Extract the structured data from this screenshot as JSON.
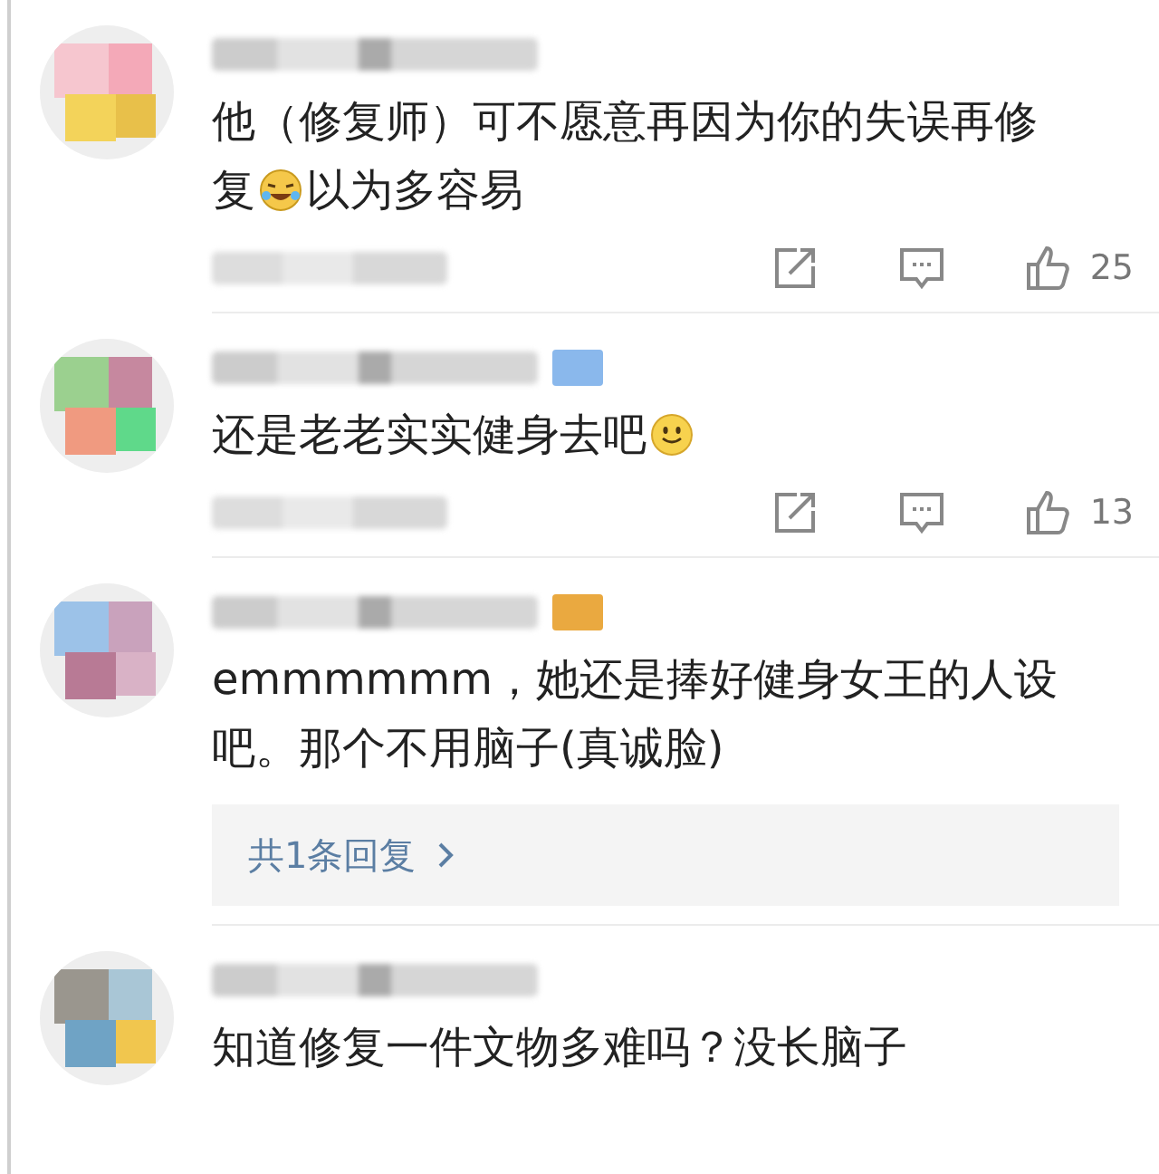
{
  "comments": [
    {
      "body": [
        {
          "kind": "text",
          "text": "他（修复师）可不愿意再因为你的失误再修复"
        },
        {
          "kind": "laughing"
        },
        {
          "kind": "text",
          "text": "以为多容易"
        }
      ],
      "likes": "25"
    },
    {
      "color": "#8ab8ec",
      "body": [
        {
          "kind": "text",
          "text": "还是老老实实健身去吧"
        },
        {
          "kind": "smiling"
        }
      ],
      "likes": "13"
    },
    {
      "color": "#eaa940",
      "body": [
        {
          "kind": "text",
          "text": "emmmmmm，她还是捧好健身女王的人设吧。那个不用脑子(真诚脸)"
        }
      ],
      "replies": "共1条回复"
    },
    {
      "body": [
        {
          "kind": "text",
          "text": "知道修复一件文物多难吗？没长脑子"
        }
      ]
    }
  ]
}
